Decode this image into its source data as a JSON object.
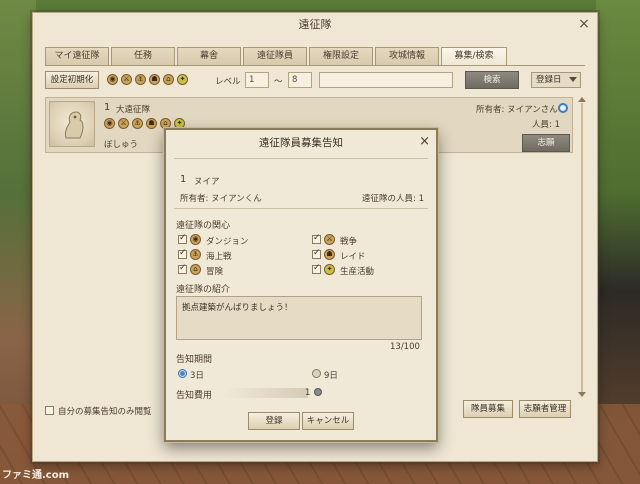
{
  "window": {
    "title": "遠征隊"
  },
  "tabs": [
    {
      "label": "マイ遠征隊"
    },
    {
      "label": "任務"
    },
    {
      "label": "幕舎"
    },
    {
      "label": "遠征隊員"
    },
    {
      "label": "権限設定"
    },
    {
      "label": "攻城情報"
    },
    {
      "label": "募集/検索"
    }
  ],
  "filter": {
    "reset_label": "設定初期化",
    "level_label": "レベル",
    "level_min": "1",
    "level_sep": "～",
    "level_max": "8",
    "search_placeholder": "",
    "search_label": "検索",
    "sort_value": "登録日"
  },
  "list": {
    "items": [
      {
        "number": "1",
        "name": "大遠征隊",
        "owner": "所有者: ヌイアンさん",
        "members": "人員: 1",
        "status": "ぼしゅう",
        "apply_label": "志願"
      }
    ]
  },
  "bottom": {
    "mine_only_label": "自分の募集告知のみ閲覧",
    "recruit_label": "隊員募集",
    "manage_label": "志願者管理"
  },
  "modal": {
    "title": "遠征隊員募集告知",
    "number": "1",
    "name": "ヌイア",
    "owner": "所有者: ヌイアンくん",
    "members": "遠征隊の人員: 1",
    "interest_label": "遠征隊の関心",
    "interests": [
      {
        "label": "ダンジョン"
      },
      {
        "label": "戦争"
      },
      {
        "label": "海上戦"
      },
      {
        "label": "レイド"
      },
      {
        "label": "冒険"
      },
      {
        "label": "生産活動"
      }
    ],
    "intro_label": "遠征隊の紹介",
    "intro_text": "拠点建築がんばりましょう！",
    "char_count": "13/100",
    "period_label": "告知期間",
    "period_options": [
      {
        "label": "3日",
        "selected": true
      },
      {
        "label": "9日",
        "selected": false
      }
    ],
    "cost_label": "告知費用",
    "cost_value": "1",
    "ok_label": "登録",
    "cancel_label": "キャンセル"
  },
  "watermark": "ファミ通.com"
}
